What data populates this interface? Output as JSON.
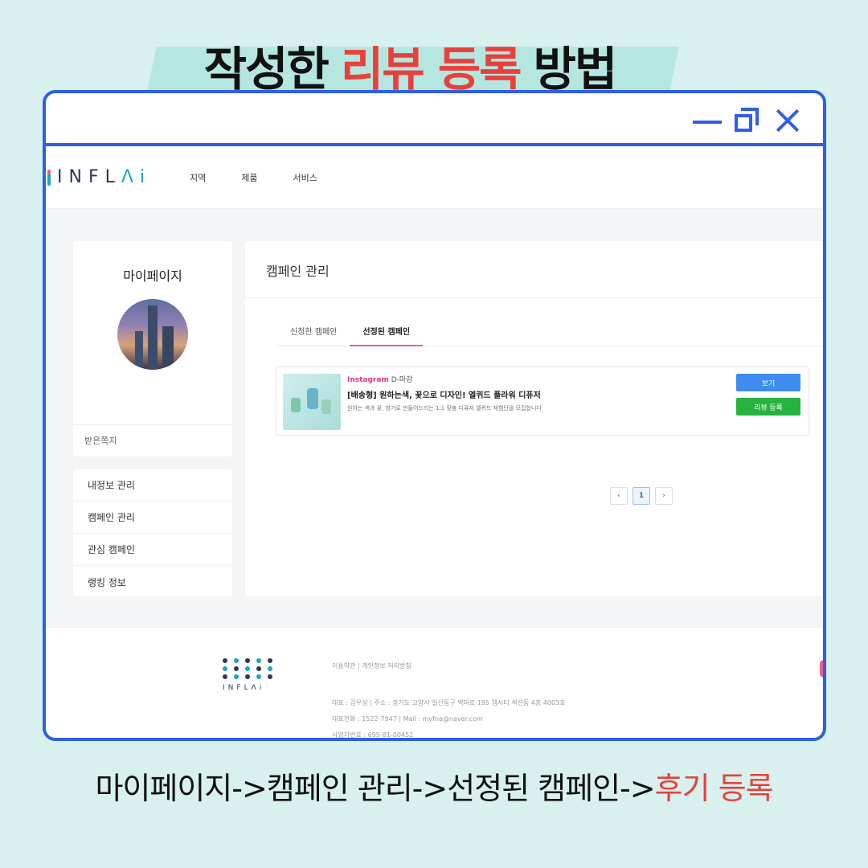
{
  "headline": {
    "part1": "작성한",
    "highlight": "리뷰 등록",
    "part2": "방법"
  },
  "colors": {
    "accent_red": "#e8403a",
    "frame_blue": "#2f5fe6",
    "background": "#d8f1ee",
    "banner": "#b6e6e0"
  },
  "window_controls": {
    "minimize": "minimize-icon",
    "maximize": "maximize-icon",
    "close": "close-icon"
  },
  "site": {
    "logo": {
      "text": "INFL",
      "accent": "Λi"
    },
    "nav": [
      "지역",
      "제품",
      "서비스"
    ]
  },
  "sidebar": {
    "title": "마이페이지",
    "note": "받은쪽지",
    "menu": [
      "내정보 관리",
      "캠페인 관리",
      "관심 캠페인",
      "랭킹 정보"
    ]
  },
  "main": {
    "title": "캠페인 관리",
    "tabs": [
      "신청한 캠페인",
      "선정된 캠페인"
    ],
    "campaign": {
      "platform": "Instagram",
      "deadline": "D-마감",
      "title": "[배송형] 원하는색, 꽃으로 디자인! 엘퀴드 플라워 디퓨저",
      "desc": "원하는 색과 꽃, 향기로 만들어드리는 1:1 맞춤 디퓨저 엘퀴드 체험단을 모집합니다",
      "view_label": "보기",
      "review_label": "리뷰 등록"
    },
    "pagination": {
      "prev": "‹",
      "current": "1",
      "next": "›"
    }
  },
  "footer": {
    "logo_text": "INFLΛi",
    "links": "이용약관 | 개인정보 처리방침",
    "info": [
      "대표 : 김우성 | 주소 : 경기도 고양시 일산동구 백마로 195 엠시티 섹션동 4층 4003호",
      "대표전화 : 1522-7947 | Mail : myfna@naver.com",
      "사업자번호 : 695-81-00452"
    ]
  },
  "caption": {
    "path": "마이페이지->캠페인 관리->선정된 캠페인->",
    "highlight": "후기 등록"
  }
}
